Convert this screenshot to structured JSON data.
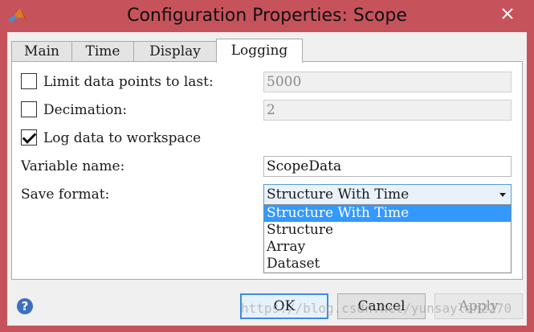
{
  "window": {
    "title": "Configuration Properties: Scope",
    "app_icon": "matlab-logo-icon",
    "close_icon": "close-icon"
  },
  "tabs": [
    {
      "label": "Main",
      "active": false
    },
    {
      "label": "Time",
      "active": false
    },
    {
      "label": "Display",
      "active": false
    },
    {
      "label": "Logging",
      "active": true
    }
  ],
  "logging": {
    "limit_points": {
      "label": "Limit data points to last:",
      "checked": false,
      "value": "5000",
      "enabled": false
    },
    "decimation": {
      "label": "Decimation:",
      "checked": false,
      "value": "2",
      "enabled": false
    },
    "log_to_workspace": {
      "label": "Log data to workspace",
      "checked": true
    },
    "variable_name": {
      "label": "Variable name:",
      "value": "ScopeData"
    },
    "save_format": {
      "label": "Save format:",
      "selected": "Structure With Time",
      "options": [
        "Structure With Time",
        "Structure",
        "Array",
        "Dataset"
      ]
    }
  },
  "buttons": {
    "ok": "OK",
    "cancel": "Cancel",
    "apply": "Apply",
    "help_glyph": "?"
  },
  "watermark": "https://blog.csdn.net/yunsaylan2270",
  "colors": {
    "titlebar": "#c6535b",
    "selection": "#3399ff",
    "default_button_border": "#3c8be0"
  }
}
